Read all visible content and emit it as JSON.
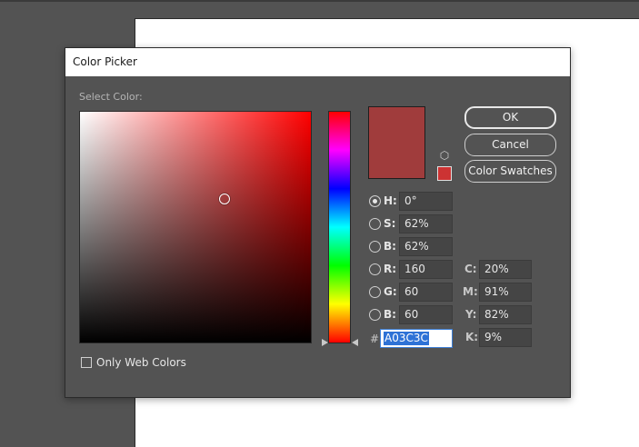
{
  "dialog": {
    "title": "Color Picker",
    "select_color_label": "Select Color:",
    "only_web_colors_label": "Only Web Colors",
    "only_web_colors_checked": false
  },
  "buttons": {
    "ok": "OK",
    "cancel": "Cancel",
    "color_swatches": "Color Swatches"
  },
  "color": {
    "current_hex": "#A03C3C",
    "websafe_hex": "#CC3333",
    "hue_base": "#FF0000"
  },
  "fields": {
    "h": {
      "label": "H:",
      "value": "0°",
      "selected": true
    },
    "s": {
      "label": "S:",
      "value": "62%",
      "selected": false
    },
    "b": {
      "label": "B:",
      "value": "62%",
      "selected": false
    },
    "r": {
      "label": "R:",
      "value": "160",
      "selected": false
    },
    "g": {
      "label": "G:",
      "value": "60",
      "selected": false
    },
    "bb": {
      "label": "B:",
      "value": "60",
      "selected": false
    },
    "c": {
      "label": "C:",
      "value": "20%"
    },
    "m": {
      "label": "M:",
      "value": "91%"
    },
    "y": {
      "label": "Y:",
      "value": "82%"
    },
    "k": {
      "label": "K:",
      "value": "9%"
    },
    "hex": {
      "prefix": "#",
      "value": "A03C3C"
    }
  },
  "icons": {
    "gamut_warning": "cube-icon",
    "selection_marker": "circle-marker-icon",
    "slider_arrows": "triangle-arrow-icon"
  }
}
